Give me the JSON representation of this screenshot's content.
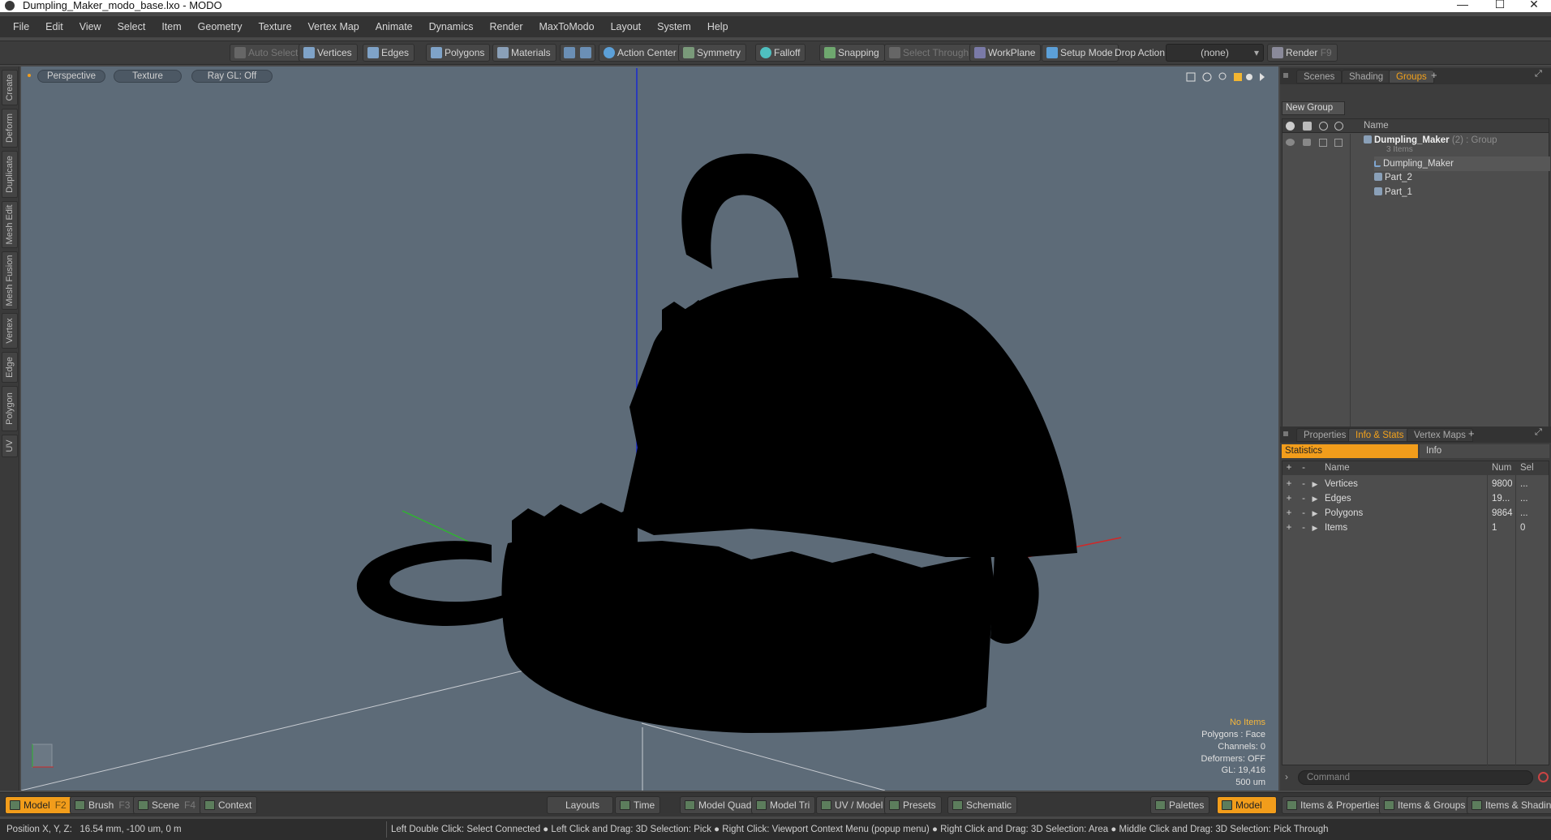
{
  "window": {
    "title": "Dumpling_Maker_modo_base.lxo - MODO",
    "minimize": "—",
    "maximize": "☐",
    "close": "✕"
  },
  "menu": [
    "File",
    "Edit",
    "View",
    "Select",
    "Item",
    "Geometry",
    "Texture",
    "Vertex Map",
    "Animate",
    "Dynamics",
    "Render",
    "MaxToModo",
    "Layout",
    "System",
    "Help"
  ],
  "toolbar": {
    "auto_select": "Auto Select",
    "vertices": "Vertices",
    "edges": "Edges",
    "polygons": "Polygons",
    "materials": "Materials",
    "action_center": "Action Center",
    "symmetry": "Symmetry",
    "falloff": "Falloff",
    "snapping": "Snapping",
    "select_through": "Select Through",
    "workplane": "WorkPlane",
    "setup_mode": "Setup Mode",
    "drop_action_label": "Drop Action",
    "drop_action_value": "(none)",
    "render": "Render",
    "render_key": "F9"
  },
  "left_tabs": [
    "Create",
    "Deform",
    "Duplicate",
    "Mesh Edit",
    "Mesh Fusion",
    "Vertex",
    "Edge",
    "Polygon",
    "UV"
  ],
  "viewport": {
    "view": "Perspective",
    "shading": "Texture",
    "raygl": "Ray GL: Off",
    "info": {
      "selection": "No Items",
      "polygons": "Polygons : Face",
      "channels": "Channels: 0",
      "deformers": "Deformers: OFF",
      "gl": "GL: 19,416",
      "scale": "500 um"
    }
  },
  "scene_panel": {
    "tabs": [
      "Scenes",
      "Shading",
      "Groups"
    ],
    "active_tab": "Groups",
    "new_group": "New Group",
    "name_header": "Name",
    "group": {
      "name": "Dumpling_Maker",
      "count": "(2)",
      "kind": ": Group",
      "items_label": "3 Items"
    },
    "children": [
      "Dumpling_Maker",
      "Part_2",
      "Part_1"
    ]
  },
  "props_panel": {
    "tabs": [
      "Properties",
      "Info & Stats",
      "Vertex Maps"
    ],
    "active_tab": "Info & Stats",
    "subtabs": [
      "Statistics",
      "Info"
    ],
    "headers": {
      "name": "Name",
      "num": "Num",
      "sel": "Sel"
    },
    "rows": [
      {
        "name": "Vertices",
        "num": "9800",
        "sel": "..."
      },
      {
        "name": "Edges",
        "num": "19...",
        "sel": "..."
      },
      {
        "name": "Polygons",
        "num": "9864",
        "sel": "..."
      },
      {
        "name": "Items",
        "num": "1",
        "sel": "0"
      }
    ],
    "command_placeholder": "Command"
  },
  "bottom": {
    "model": "Model",
    "model_key": "F2",
    "brush": "Brush",
    "brush_key": "F3",
    "scene": "Scene",
    "scene_key": "F4",
    "context": "Context",
    "layouts": "Layouts",
    "time": "Time",
    "model_quad": "Model Quad",
    "model_tri": "Model Tri",
    "uv_model": "UV / Model",
    "presets": "Presets",
    "schematic": "Schematic",
    "palettes": "Palettes",
    "model2": "Model",
    "items_properties": "Items & Properties",
    "items_groups": "Items & Groups",
    "items_shading": "Items & Shading"
  },
  "status": {
    "position": "Position X, Y, Z:   16.54 mm, -100 um, 0 m",
    "hints": "Left Double Click: Select Connected ● Left Click and Drag: 3D Selection: Pick ● Right Click: Viewport Context Menu (popup menu) ● Right Click and Drag: 3D Selection: Area ● Middle Click and Drag: 3D Selection: Pick Through"
  },
  "colors": {
    "accent": "#f29d1b",
    "viewport_bg": "#5d6b78",
    "model": "#000000"
  }
}
